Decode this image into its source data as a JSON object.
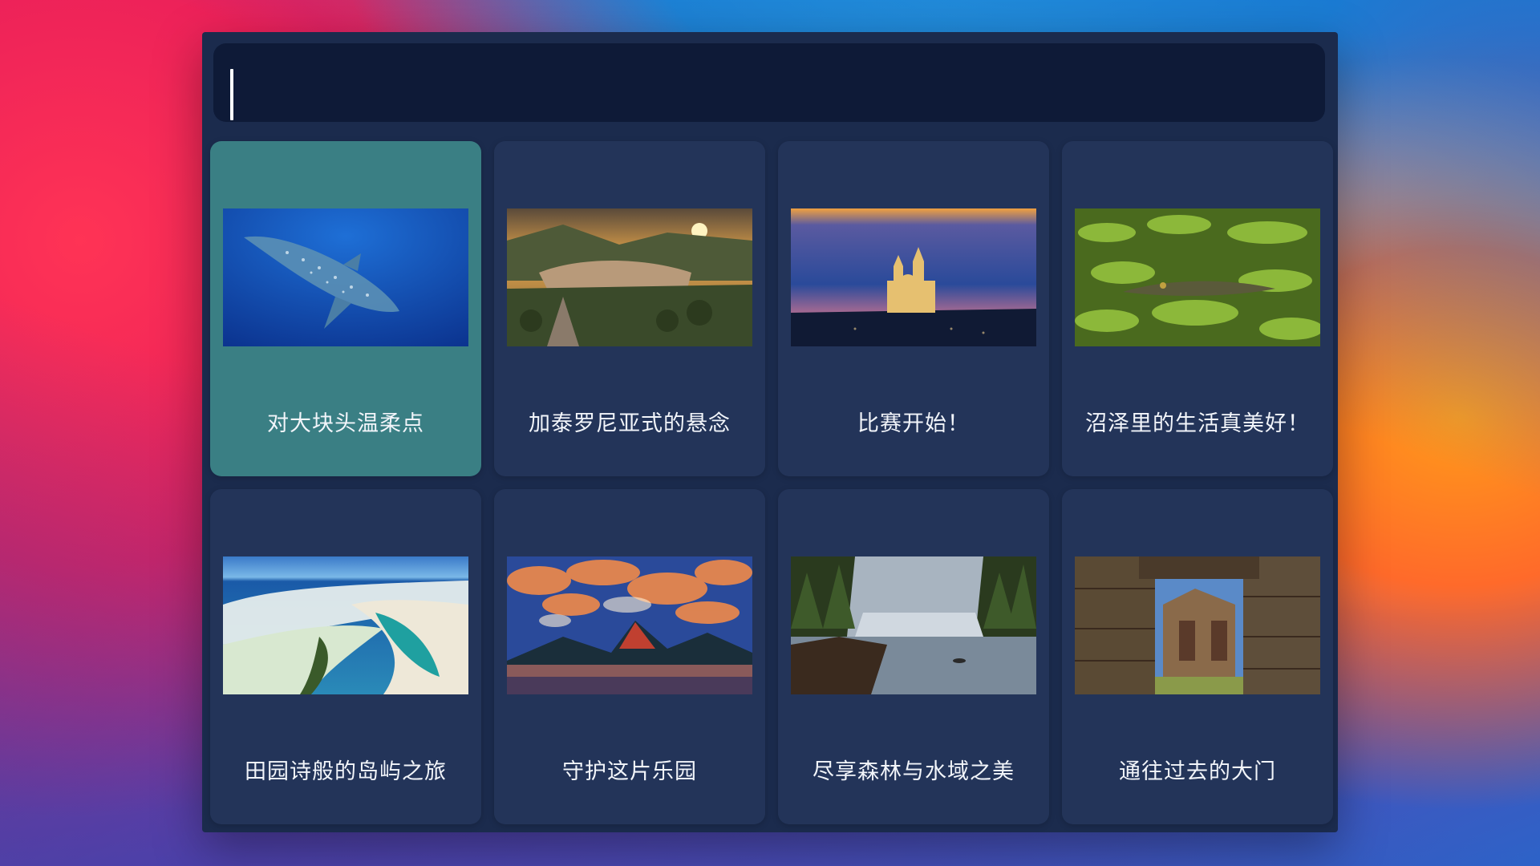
{
  "search": {
    "value": "",
    "placeholder": ""
  },
  "tiles": [
    {
      "title": "对大块头温柔点",
      "image": "whale-shark-underwater",
      "selected": true
    },
    {
      "title": "加泰罗尼亚式的悬念",
      "image": "cliff-village-sunset",
      "selected": false
    },
    {
      "title": "比赛开始！",
      "image": "cathedral-night-sky",
      "selected": false
    },
    {
      "title": "沼泽里的生活真美好！",
      "image": "crocodile-lily-pads",
      "selected": false
    },
    {
      "title": "田园诗般的岛屿之旅",
      "image": "tropical-island-aerial",
      "selected": false
    },
    {
      "title": "守护这片乐园",
      "image": "mountain-lake-sunset-clouds",
      "selected": false
    },
    {
      "title": "尽享森林与水域之美",
      "image": "forest-lake-canoe",
      "selected": false
    },
    {
      "title": "通往过去的大门",
      "image": "ancient-temple-gate",
      "selected": false
    }
  ],
  "colors": {
    "panel": "#1b2b4d",
    "search_bar": "#0e1a37",
    "tile": "#24365c",
    "tile_selected": "#3a7f84",
    "label_text": "#f2f5fa"
  }
}
